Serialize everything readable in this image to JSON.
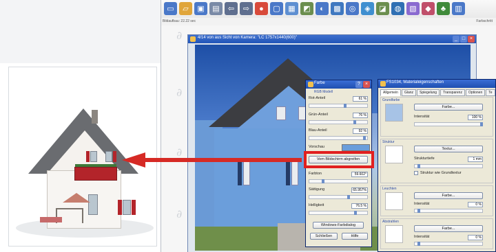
{
  "app": {
    "status_left": "Bildaufbau: 22.22 sec",
    "status_right": "Farbschritt",
    "toolbar_icons": [
      "new-icon",
      "open-icon",
      "save-icon",
      "print-icon",
      "undo-icon",
      "redo-icon",
      "render-icon",
      "object-icon",
      "image-icon",
      "view-icon",
      "light-icon",
      "camera-icon",
      "zoom-icon",
      "material-icon",
      "texture-icon",
      "plant-icon",
      "cube-icon",
      "color-icon",
      "tree-icon",
      "window-icon"
    ]
  },
  "main_window": {
    "title": "4/14 von aus Sicht von Kamera: \"LC 1757x1440(600)\""
  },
  "color_dialog": {
    "title": "Farbe",
    "rgb_group": "RGB Modell",
    "red_label": "Rot-Anteil",
    "red_value": "61 %",
    "green_label": "Grün-Anteil",
    "green_value": "76 %",
    "blue_label": "Blau-Anteil",
    "blue_value": "92 %",
    "preview_label": "Vorschau",
    "pick_button": "Vom Bildschirm abgreifen",
    "hsl_group": "HSL Modell",
    "hue_label": "Farbton",
    "hue_value": "59.602°",
    "sat_label": "Sättigung",
    "sat_value": "65.957%",
    "light_label": "Helligkeit",
    "light_value": "76.5 %",
    "windows_button": "Windows-Farbdialog",
    "close_button": "Schließen",
    "help_button": "Hilfe"
  },
  "material_window": {
    "title": "FS1034, Materialeigenschaften",
    "tabs": [
      "Allgemein",
      "Glanz",
      "Spiegelung",
      "Transparenz",
      "Optionen",
      "Te"
    ],
    "base_color": "Grundfarbe",
    "color_button": "Farbe...",
    "intensity_label": "Intensität",
    "intensity_value": "100 %",
    "structure": "Struktur",
    "texture_button": "Textur...",
    "structure_depth_label": "Strukturtiefe",
    "structure_depth_value": "1 mm",
    "structure_check": "Struktur wie Grundtextur",
    "glow": "Leuchten",
    "glow_button": "Farbe...",
    "glow_intensity_label": "Intensität",
    "glow_intensity_value": "0 %",
    "dim": "Abstrahlen",
    "dim_button": "Farbe...",
    "dim_intensity_label": "Intensität",
    "dim_intensity_value": "0 %"
  }
}
